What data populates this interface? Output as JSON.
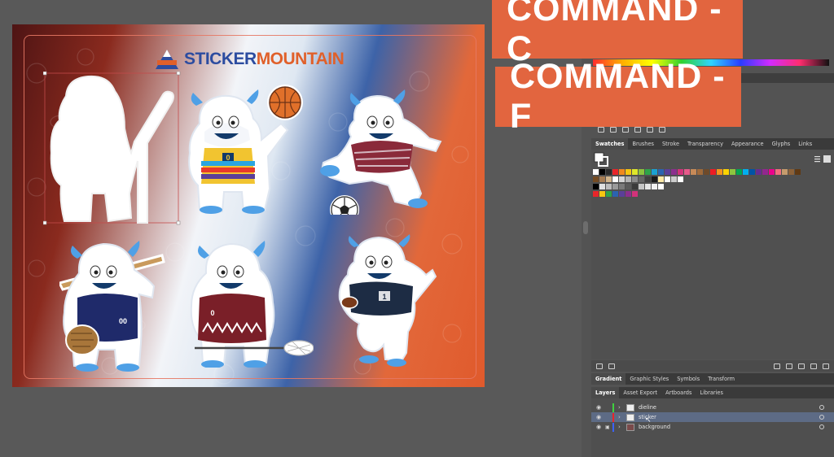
{
  "overlay": {
    "banner_c": "COMMAND - C",
    "banner_f": "COMMAND - F"
  },
  "artboard": {
    "logo_text_1": "STICKER",
    "logo_text_2": "MOUNTAIN",
    "logo_mark_text": "STICKER MOUNTAIN"
  },
  "stickers": [
    {
      "name": "yeti-hockey-silhouette",
      "jersey": ""
    },
    {
      "name": "yeti-basketball",
      "jersey": "0"
    },
    {
      "name": "yeti-soccer",
      "jersey": ""
    },
    {
      "name": "yeti-baseball",
      "jersey": "00"
    },
    {
      "name": "yeti-lacrosse",
      "jersey": "0"
    },
    {
      "name": "yeti-football",
      "jersey": "1"
    }
  ],
  "swatch_panel": {
    "tabs": [
      "Swatches",
      "Brushes",
      "Stroke",
      "Transparency",
      "Appearance",
      "Glyphs",
      "Links"
    ],
    "active_tab": "Swatches",
    "colors_row1": [
      "#ffffff",
      "#000000",
      "#2b2b2b",
      "#e8262a",
      "#f0891f",
      "#f6c611",
      "#dfe72a",
      "#8bc43f",
      "#2ea349",
      "#1ba1d1",
      "#2b63b0",
      "#5b3f99",
      "#8b2f8e",
      "#d2327a",
      "#e65a8a",
      "#c78a58",
      "#a06a3a",
      "#6e4a2a",
      "#ed1c24",
      "#f7941d",
      "#fbd300",
      "#8dc63f",
      "#00a651",
      "#00aeef",
      "#0054a6",
      "#662d91",
      "#92278f",
      "#ec008c",
      "#f26d7d",
      "#c69c6d",
      "#8c6239",
      "#603913"
    ],
    "colors_row2": [
      "#754c24",
      "#a67c52",
      "#d0b38a",
      "#ffffff",
      "#d6d6d6",
      "#b3b3b3",
      "#8c8c8c",
      "#666666",
      "#404040",
      "#1a1a1a",
      "#ffe9a6",
      "#ffffff",
      "#cccccc",
      "#ffffff"
    ],
    "colors_row3": [
      "#000000",
      "#e0e0e0",
      "#bcbcbc",
      "#9a9a9a",
      "#7a7a7a",
      "#5a5a5a",
      "#3b3b3b",
      "#c6c6c6",
      "#e6e6e6",
      "#f2f2f2",
      "#ffffff"
    ],
    "colors_row4": [
      "#e8262a",
      "#f6c611",
      "#2ea349",
      "#2b63b0",
      "#5b3f99",
      "#8b2f8e",
      "#d2327a"
    ]
  },
  "gradient_panel": {
    "tabs": [
      "Gradient",
      "Graphic Styles",
      "Symbols",
      "Transform"
    ],
    "active_tab": "Gradient"
  },
  "layers_panel": {
    "tabs": [
      "Layers",
      "Asset Export",
      "Artboards",
      "Libraries"
    ],
    "active_tab": "Layers",
    "layers": [
      {
        "name": "dieline",
        "color": "#3fd13f",
        "locked": false,
        "selected": false
      },
      {
        "name": "sticker",
        "color": "#e8262a",
        "locked": false,
        "selected": true
      },
      {
        "name": "background",
        "color": "#3b63ff",
        "locked": true,
        "selected": false
      }
    ]
  }
}
